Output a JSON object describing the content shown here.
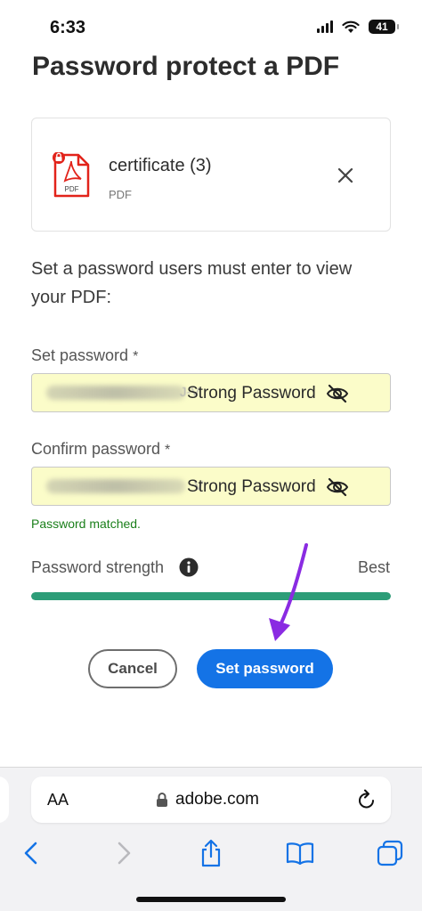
{
  "status_bar": {
    "time": "6:33",
    "battery": "41"
  },
  "page": {
    "title": "Password protect a PDF"
  },
  "file": {
    "name": "certificate (3)",
    "type": "PDF",
    "icon_label": "PDF"
  },
  "instructions": "Set a password users must enter to view your PDF:",
  "set_password": {
    "label": "Set password",
    "required_mark": "*",
    "masked_tail": "J-V",
    "strength_text": "Strong Password"
  },
  "confirm_password": {
    "label": "Confirm password",
    "required_mark": "*",
    "masked_tail": "V",
    "strength_text": "Strong Password"
  },
  "match_message": "Password matched.",
  "strength": {
    "label": "Password strength",
    "value": "Best",
    "level": 1.0
  },
  "buttons": {
    "cancel": "Cancel",
    "submit": "Set password"
  },
  "browser": {
    "aa": "AA",
    "url": "adobe.com"
  },
  "colors": {
    "primary": "#1473e6",
    "success": "#1a7f1a",
    "strength_bar": "#2d9d78",
    "input_fill": "#fbfcc9",
    "pdf_red": "#e2231a",
    "annotation_arrow": "#8a2be2"
  },
  "icons": {
    "file": "pdf-lock-icon",
    "remove": "close-icon",
    "visibility": "eye-slash-icon",
    "info": "info-icon",
    "lock": "lock-icon",
    "reload": "reload-icon",
    "back": "chevron-left-icon",
    "forward": "chevron-right-icon",
    "share": "share-icon",
    "bookmarks": "book-icon",
    "tabs": "tabs-icon"
  }
}
